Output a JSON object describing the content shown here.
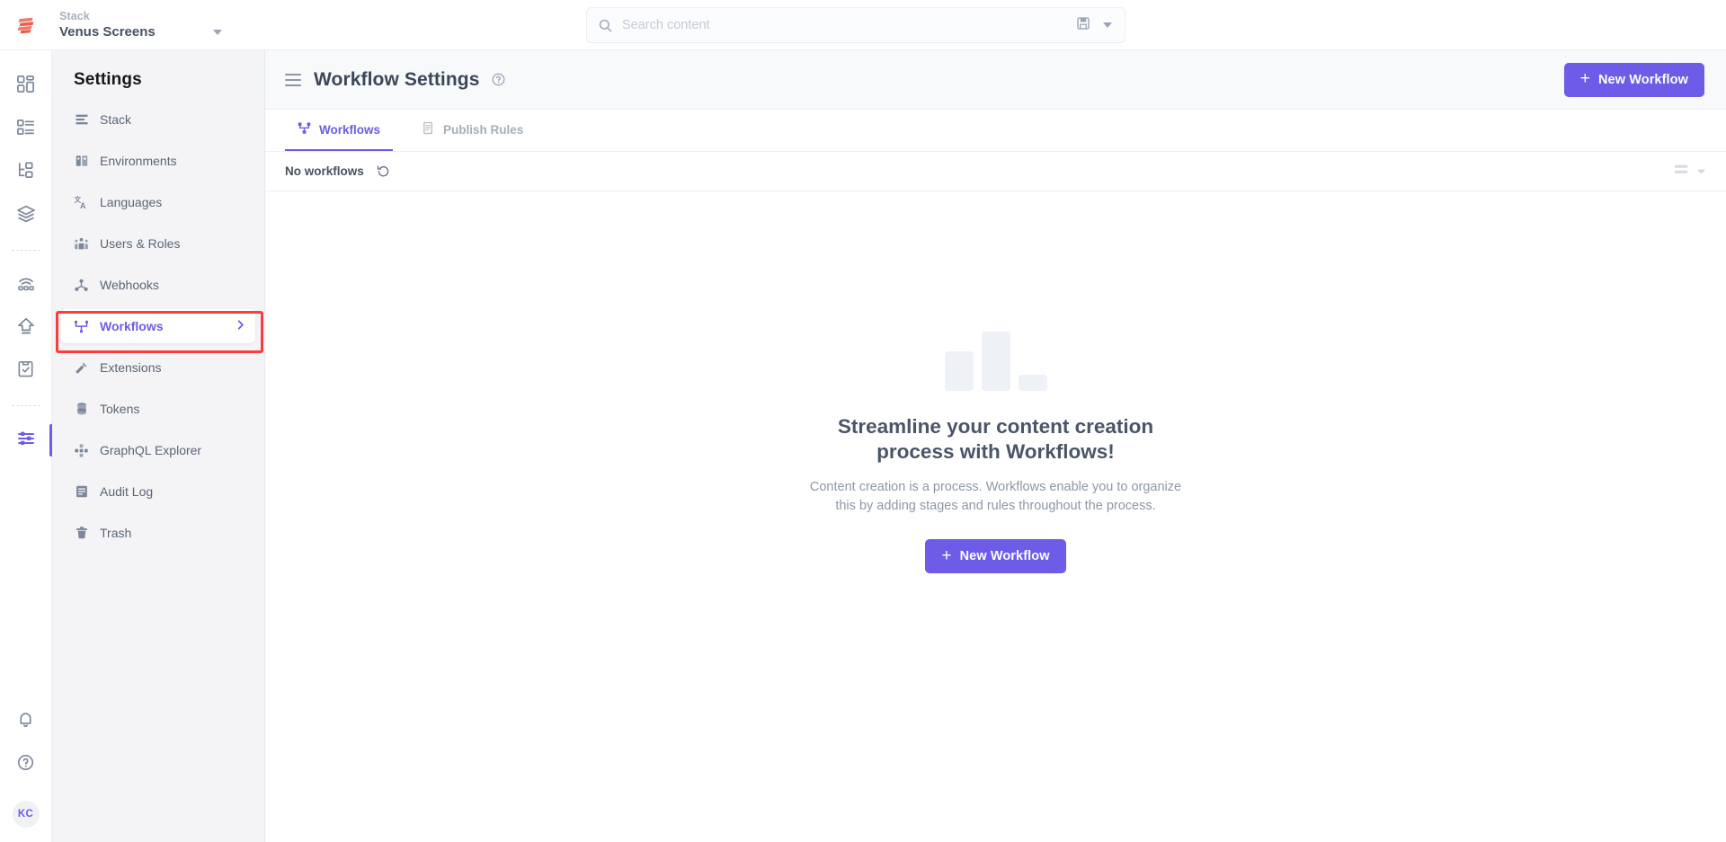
{
  "topbar": {
    "logo_name": "contentstack-logo",
    "stack_label": "Stack",
    "stack_name": "Venus Screens",
    "search": {
      "placeholder": "Search content",
      "value": "",
      "icon": "search-icon",
      "save_icon": "save-disk-icon",
      "dropdown_icon": "chevron-down-icon"
    }
  },
  "icon_rail": {
    "items": [
      {
        "name": "dashboard-icon",
        "label": "Dashboard",
        "active": false
      },
      {
        "name": "entries-icon",
        "label": "Entries",
        "active": false
      },
      {
        "name": "content-types-icon",
        "label": "Content Models",
        "active": false
      },
      {
        "name": "assets-icon",
        "label": "Assets",
        "active": false
      },
      {
        "name": "live-preview-icon",
        "label": "Live Preview",
        "active": false
      },
      {
        "name": "releases-icon",
        "label": "Releases",
        "active": false
      },
      {
        "name": "tasks-icon",
        "label": "Tasks",
        "active": false
      },
      {
        "name": "settings-icon",
        "label": "Settings",
        "active": true
      }
    ],
    "bottom": {
      "notifications_icon": "bell-icon",
      "help_icon": "help-circle-icon",
      "avatar_initials": "KC"
    }
  },
  "sidebar": {
    "title": "Settings",
    "items": [
      {
        "label": "Stack",
        "icon": "stack-icon",
        "active": false
      },
      {
        "label": "Environments",
        "icon": "environments-icon",
        "active": false
      },
      {
        "label": "Languages",
        "icon": "languages-icon",
        "active": false
      },
      {
        "label": "Users & Roles",
        "icon": "users-roles-icon",
        "active": false
      },
      {
        "label": "Webhooks",
        "icon": "webhooks-icon",
        "active": false
      },
      {
        "label": "Workflows",
        "icon": "workflows-icon",
        "active": true
      },
      {
        "label": "Extensions",
        "icon": "extensions-icon",
        "active": false
      },
      {
        "label": "Tokens",
        "icon": "tokens-icon",
        "active": false
      },
      {
        "label": "GraphQL Explorer",
        "icon": "graphql-explorer-icon",
        "active": false
      },
      {
        "label": "Audit Log",
        "icon": "audit-log-icon",
        "active": false
      },
      {
        "label": "Trash",
        "icon": "trash-icon",
        "active": false
      }
    ],
    "highlight_target": "Workflows"
  },
  "page": {
    "menu_icon": "hamburger-icon",
    "title": "Workflow Settings",
    "help_icon": "help-circle-icon",
    "new_workflow_label": "New Workflow",
    "plus_glyph": "+"
  },
  "tabs": [
    {
      "label": "Workflows",
      "icon": "workflows-tab-icon",
      "active": true
    },
    {
      "label": "Publish Rules",
      "icon": "publish-rules-tab-icon",
      "active": false
    }
  ],
  "list_bar": {
    "count_text": "No workflows",
    "refresh_icon": "refresh-icon",
    "view_icon": "list-view-icon",
    "view_caret_icon": "chevron-down-icon"
  },
  "empty_state": {
    "illustration": "bar-chart-illustration",
    "title": "Streamline your content creation process with Workflows!",
    "description": "Content creation is a process. Workflows enable you to organize this by adding stages and rules throughout the process.",
    "cta_label": "New Workflow",
    "cta_plus": "+"
  },
  "colors": {
    "accent": "#6c5ce7",
    "highlight": "#fa3c3c",
    "sidebar_bg": "#f4f4f6",
    "header_bg": "#f8f9fb",
    "text_dark": "#3b4757",
    "text_muted": "#8e97a6"
  }
}
